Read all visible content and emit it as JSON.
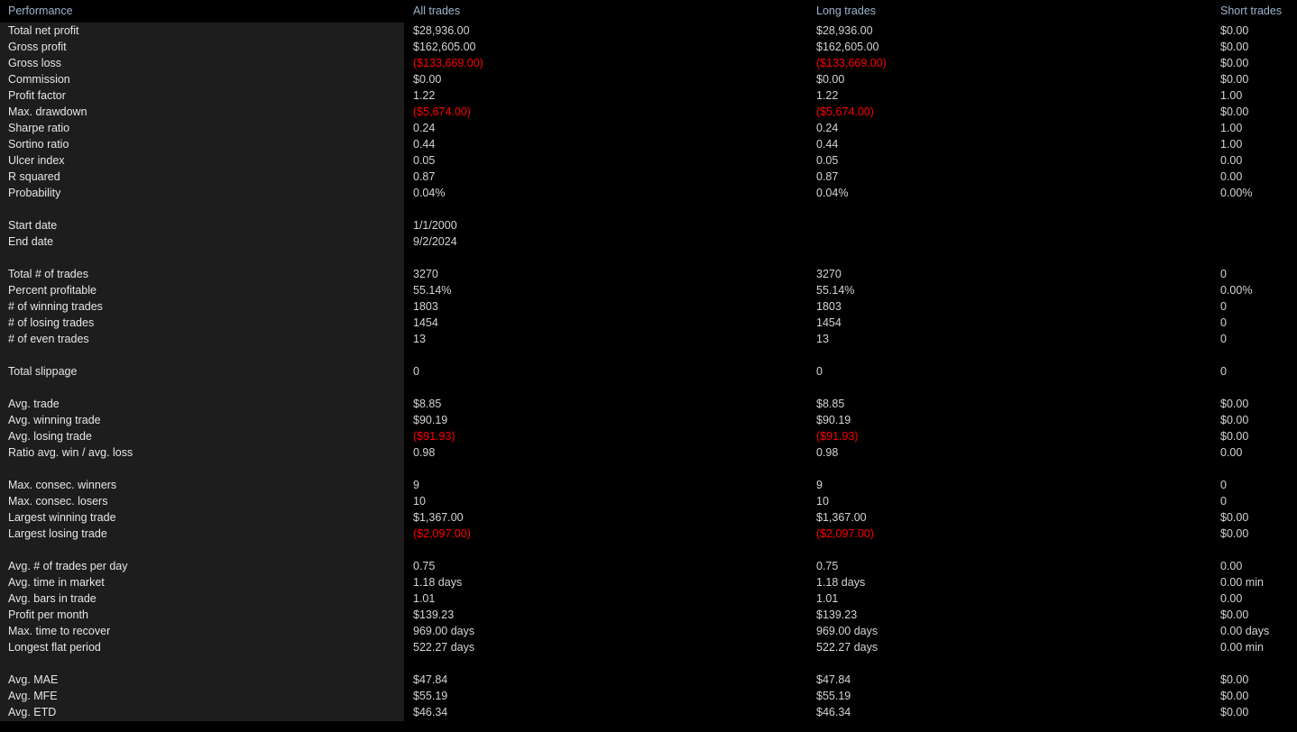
{
  "colors": {
    "background": "#000000",
    "label_panel": "#1d1d1d",
    "header_text": "#9cb4cc",
    "value_text": "#d4d4d4",
    "label_text": "#e6e6e6",
    "negative": "#ff0000"
  },
  "header": {
    "performance": "Performance",
    "all_trades": "All trades",
    "long_trades": "Long trades",
    "short_trades": "Short trades"
  },
  "rows": [
    {
      "label": "Total net profit",
      "all": "$28,936.00",
      "long": "$28,936.00",
      "short": "$0.00"
    },
    {
      "label": "Gross profit",
      "all": "$162,605.00",
      "long": "$162,605.00",
      "short": "$0.00"
    },
    {
      "label": "Gross loss",
      "all": "($133,669.00)",
      "long": "($133,669.00)",
      "short": "$0.00",
      "all_neg": true,
      "long_neg": true
    },
    {
      "label": "Commission",
      "all": "$0.00",
      "long": "$0.00",
      "short": "$0.00"
    },
    {
      "label": "Profit factor",
      "all": "1.22",
      "long": "1.22",
      "short": "1.00"
    },
    {
      "label": "Max. drawdown",
      "all": "($5,674.00)",
      "long": "($5,674.00)",
      "short": "$0.00",
      "all_neg": true,
      "long_neg": true
    },
    {
      "label": "Sharpe ratio",
      "all": "0.24",
      "long": "0.24",
      "short": "1.00"
    },
    {
      "label": "Sortino ratio",
      "all": "0.44",
      "long": "0.44",
      "short": "1.00"
    },
    {
      "label": "Ulcer index",
      "all": "0.05",
      "long": "0.05",
      "short": "0.00"
    },
    {
      "label": "R squared",
      "all": "0.87",
      "long": "0.87",
      "short": "0.00"
    },
    {
      "label": "Probability",
      "all": "0.04%",
      "long": "0.04%",
      "short": "0.00%"
    },
    {
      "spacer": true
    },
    {
      "label": "Start date",
      "all": "1/1/2000",
      "long": "",
      "short": ""
    },
    {
      "label": "End date",
      "all": "9/2/2024",
      "long": "",
      "short": ""
    },
    {
      "spacer": true
    },
    {
      "label": "Total # of trades",
      "all": "3270",
      "long": "3270",
      "short": "0"
    },
    {
      "label": "Percent profitable",
      "all": "55.14%",
      "long": "55.14%",
      "short": "0.00%"
    },
    {
      "label": "# of winning trades",
      "all": "1803",
      "long": "1803",
      "short": "0"
    },
    {
      "label": "# of losing trades",
      "all": "1454",
      "long": "1454",
      "short": "0"
    },
    {
      "label": "# of even trades",
      "all": "13",
      "long": "13",
      "short": "0"
    },
    {
      "spacer": true
    },
    {
      "label": "Total slippage",
      "all": "0",
      "long": "0",
      "short": "0"
    },
    {
      "spacer": true
    },
    {
      "label": "Avg. trade",
      "all": "$8.85",
      "long": "$8.85",
      "short": "$0.00"
    },
    {
      "label": "Avg. winning trade",
      "all": "$90.19",
      "long": "$90.19",
      "short": "$0.00"
    },
    {
      "label": "Avg. losing trade",
      "all": "($91.93)",
      "long": "($91.93)",
      "short": "$0.00",
      "all_neg": true,
      "long_neg": true
    },
    {
      "label": "Ratio avg. win / avg. loss",
      "all": "0.98",
      "long": "0.98",
      "short": "0.00"
    },
    {
      "spacer": true
    },
    {
      "label": "Max. consec. winners",
      "all": "9",
      "long": "9",
      "short": "0"
    },
    {
      "label": "Max. consec. losers",
      "all": "10",
      "long": "10",
      "short": "0"
    },
    {
      "label": "Largest winning trade",
      "all": "$1,367.00",
      "long": "$1,367.00",
      "short": "$0.00"
    },
    {
      "label": "Largest losing trade",
      "all": "($2,097.00)",
      "long": "($2,097.00)",
      "short": "$0.00",
      "all_neg": true,
      "long_neg": true
    },
    {
      "spacer": true
    },
    {
      "label": "Avg. # of trades per day",
      "all": "0.75",
      "long": "0.75",
      "short": "0.00"
    },
    {
      "label": "Avg. time in market",
      "all": "1.18 days",
      "long": "1.18 days",
      "short": "0.00 min"
    },
    {
      "label": "Avg. bars in trade",
      "all": "1.01",
      "long": "1.01",
      "short": "0.00"
    },
    {
      "label": "Profit per month",
      "all": "$139.23",
      "long": "$139.23",
      "short": "$0.00"
    },
    {
      "label": "Max. time to recover",
      "all": "969.00 days",
      "long": "969.00 days",
      "short": "0.00 days"
    },
    {
      "label": "Longest flat period",
      "all": "522.27 days",
      "long": "522.27 days",
      "short": "0.00 min"
    },
    {
      "spacer": true
    },
    {
      "label": "Avg. MAE",
      "all": "$47.84",
      "long": "$47.84",
      "short": "$0.00"
    },
    {
      "label": "Avg. MFE",
      "all": "$55.19",
      "long": "$55.19",
      "short": "$0.00"
    },
    {
      "label": "Avg. ETD",
      "all": "$46.34",
      "long": "$46.34",
      "short": "$0.00"
    }
  ]
}
